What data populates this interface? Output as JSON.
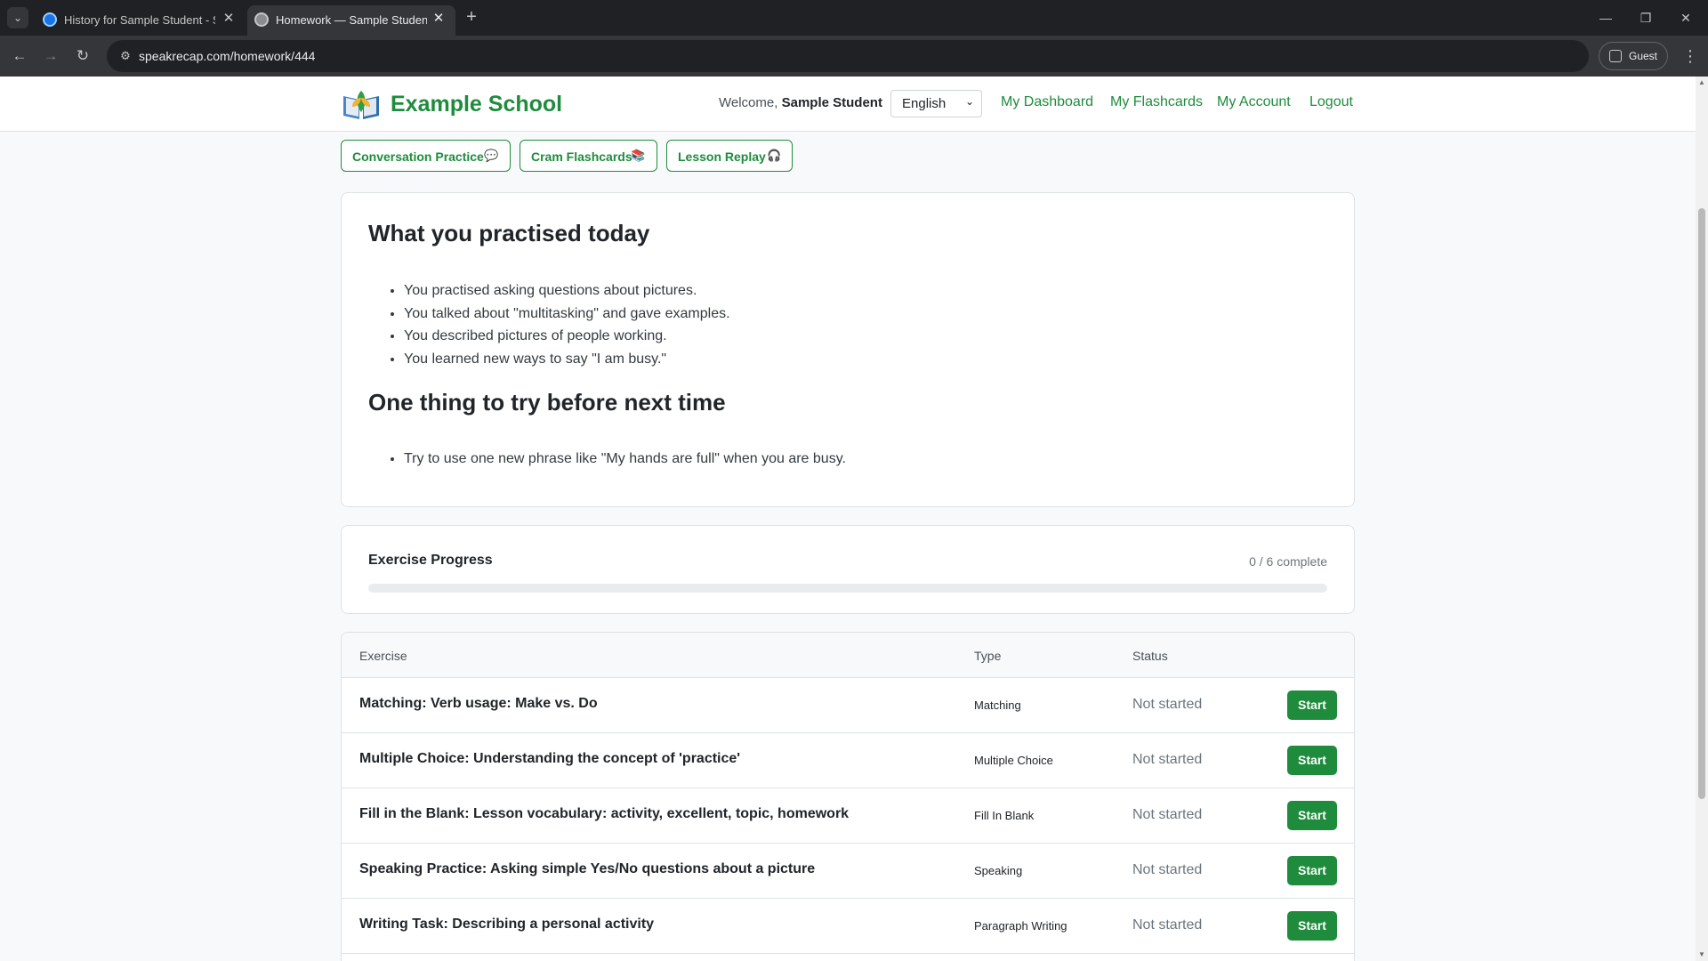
{
  "browser": {
    "tabs": [
      {
        "title": "History for Sample Student - Sp",
        "active": false
      },
      {
        "title": "Homework — Sample Student",
        "active": true
      }
    ],
    "url": "speakrecap.com/homework/444",
    "profile_label": "Guest"
  },
  "navbar": {
    "brand": "Example School",
    "welcome_prefix": "Welcome,",
    "user_name": "Sample Student",
    "language": "English",
    "links": [
      "My Dashboard",
      "My Flashcards",
      "My Account",
      "Logout"
    ]
  },
  "actions": [
    {
      "label": "Conversation Practice",
      "icon": "💬"
    },
    {
      "label": "Cram Flashcards",
      "icon": "📚"
    },
    {
      "label": "Lesson Replay",
      "icon": "🎧"
    }
  ],
  "summary": {
    "heading": "What you practised today",
    "items": [
      "You practised asking questions about pictures.",
      "You talked about \"multitasking\" and gave examples.",
      "You described pictures of people working.",
      "You learned new ways to say \"I am busy.\""
    ],
    "next_heading": "One thing to try before next time",
    "next_items": [
      "Try to use one new phrase like \"My hands are full\" when you are busy."
    ]
  },
  "progress": {
    "title": "Exercise Progress",
    "count_text": "0 / 6 complete",
    "fraction": 0
  },
  "exercises": {
    "columns": [
      "Exercise",
      "Type",
      "Status"
    ],
    "rows": [
      {
        "title": "Matching: Verb usage: Make vs. Do",
        "type": "Matching",
        "status": "Not started",
        "action": "Start"
      },
      {
        "title": "Multiple Choice: Understanding the concept of 'practice'",
        "type": "Multiple Choice",
        "status": "Not started",
        "action": "Start"
      },
      {
        "title": "Fill in the Blank: Lesson vocabulary: activity, excellent, topic, homework",
        "type": "Fill In Blank",
        "status": "Not started",
        "action": "Start"
      },
      {
        "title": "Speaking Practice: Asking simple Yes/No questions about a picture",
        "type": "Speaking",
        "status": "Not started",
        "action": "Start"
      },
      {
        "title": "Writing Task: Describing a personal activity",
        "type": "Paragraph Writing",
        "status": "Not started",
        "action": "Start"
      }
    ]
  },
  "colors": {
    "brand_green": "#1e8c3c",
    "chrome_dark": "#202124",
    "chrome_toolbar": "#35363a"
  }
}
